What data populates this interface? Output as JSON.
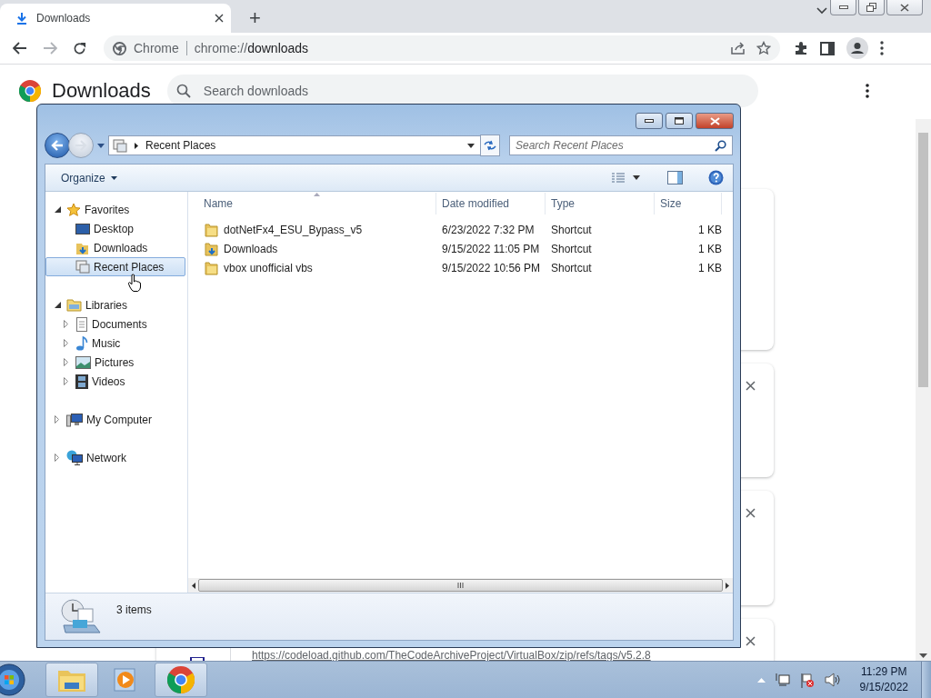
{
  "browser": {
    "tab": {
      "title": "Downloads",
      "selected": true
    },
    "new_tab": "+",
    "omnibox": {
      "site_label": "Chrome",
      "url_scheme": "chrome://",
      "url_host": "downloads"
    }
  },
  "page": {
    "title": "Downloads",
    "search": {
      "placeholder": "Search downloads"
    },
    "partial_url": "https://codeload.github.com/TheCodeArchiveProject/VirtualBox/zip/refs/tags/v5.2.8"
  },
  "explorer": {
    "address": {
      "location": "Recent Places"
    },
    "search": {
      "placeholder": "Search Recent Places"
    },
    "toolbar": {
      "organize": "Organize"
    },
    "nav": [
      {
        "label": "Favorites",
        "expanded": true,
        "selected": false,
        "children": [
          {
            "label": "Desktop",
            "selected": false
          },
          {
            "label": "Downloads",
            "selected": false
          },
          {
            "label": "Recent Places",
            "selected": true
          }
        ]
      },
      {
        "label": "Libraries",
        "expanded": true,
        "selected": false,
        "children": [
          {
            "label": "Documents",
            "selected": false,
            "expanded": false
          },
          {
            "label": "Music",
            "selected": false,
            "expanded": false
          },
          {
            "label": "Pictures",
            "selected": false,
            "expanded": false
          },
          {
            "label": "Videos",
            "selected": false,
            "expanded": false
          }
        ]
      },
      {
        "label": "My Computer",
        "expanded": false,
        "selected": false
      },
      {
        "label": "Network",
        "expanded": false,
        "selected": false
      }
    ],
    "columns": [
      "Name",
      "Date modified",
      "Type",
      "Size"
    ],
    "rows": [
      {
        "name": "dotNetFx4_ESU_Bypass_v5",
        "date": "6/23/2022 7:32 PM",
        "type": "Shortcut",
        "size": "1 KB"
      },
      {
        "name": "Downloads",
        "date": "9/15/2022 11:05 PM",
        "type": "Shortcut",
        "size": "1 KB"
      },
      {
        "name": "vbox unofficial vbs",
        "date": "9/15/2022 10:56 PM",
        "type": "Shortcut",
        "size": "1 KB"
      }
    ],
    "status": "3 items"
  },
  "taskbar": {
    "clock": {
      "time": "11:29 PM",
      "date": "9/15/2022"
    }
  }
}
